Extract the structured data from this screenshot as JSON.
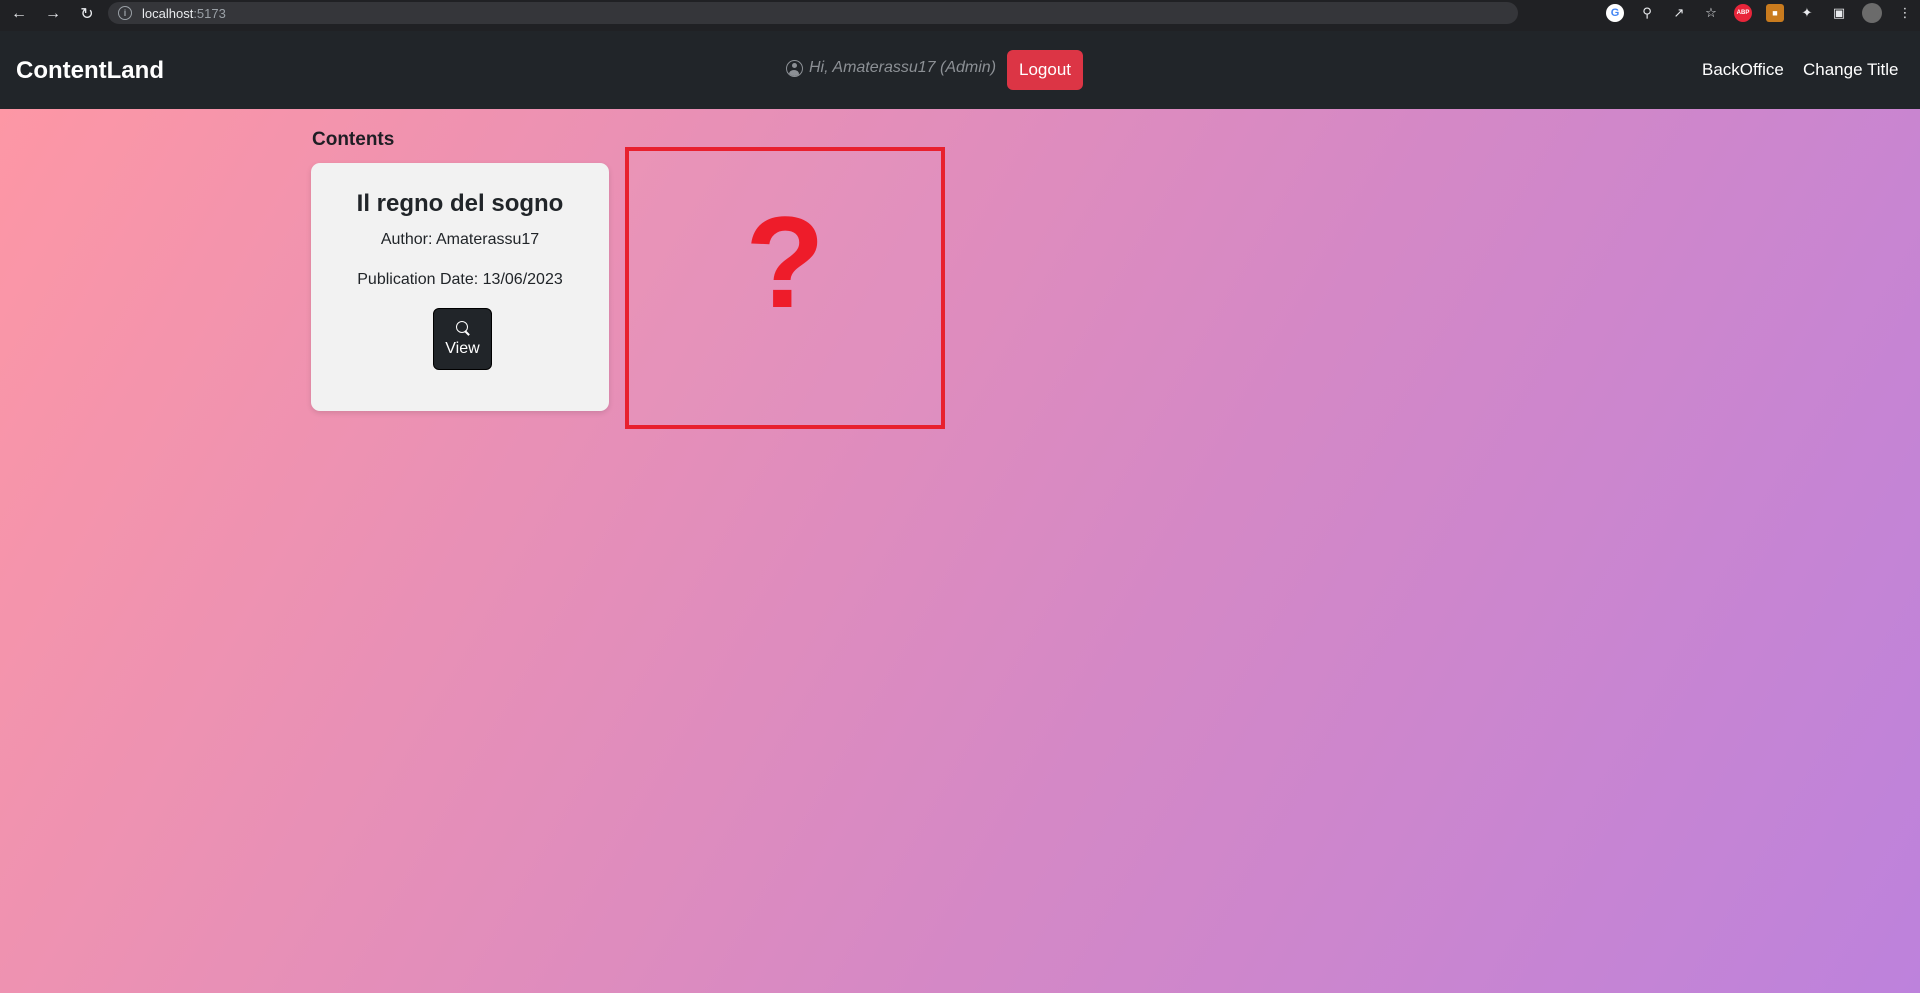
{
  "browser": {
    "url_host": "localhost",
    "url_port": ":5173",
    "nav_icons": [
      "back-icon",
      "forward-icon",
      "reload-icon"
    ],
    "extension_icons": [
      "google-icon",
      "key-icon",
      "share-icon",
      "star-icon",
      "abp-icon",
      "extension-icon",
      "puzzle-icon",
      "sidebar-icon",
      "profile-avatar",
      "menu-icon"
    ],
    "abp_label": "ABP"
  },
  "navbar": {
    "brand": "ContentLand",
    "greeting": "Hi, Amaterassu17 (Admin)",
    "logout_label": "Logout",
    "links": [
      "BackOffice",
      "Change Title"
    ]
  },
  "main": {
    "section_title": "Contents",
    "card": {
      "title": "Il regno del sogno",
      "author": "Author: Amaterassu17",
      "publication_date": "Publication Date: 13/06/2023",
      "view_label": "View"
    },
    "placeholder_symbol": "?"
  },
  "colors": {
    "navbar_bg": "#212529",
    "logout_bg": "#dc3545",
    "placeholder_border": "#e8202e",
    "gradient_start": "#fd97a5",
    "gradient_end": "#bd82dc"
  }
}
